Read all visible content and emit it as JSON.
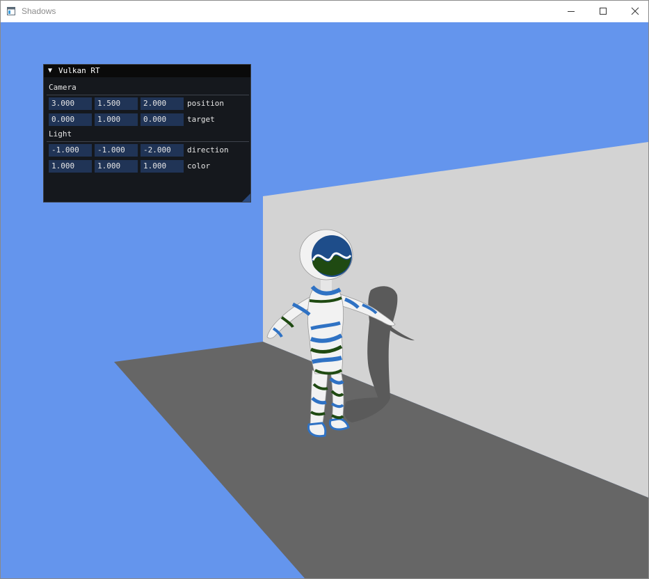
{
  "window": {
    "title": "Shadows"
  },
  "panel": {
    "title": "Vulkan RT",
    "camera": {
      "header": "Camera",
      "position": {
        "x": "3.000",
        "y": "1.500",
        "z": "2.000",
        "label": "position"
      },
      "target": {
        "x": "0.000",
        "y": "1.000",
        "z": "0.000",
        "label": "target"
      }
    },
    "light": {
      "header": "Light",
      "direction": {
        "x": "-1.000",
        "y": "-1.000",
        "z": "-2.000",
        "label": "direction"
      },
      "color": {
        "x": "1.000",
        "y": "1.000",
        "z": "1.000",
        "label": "color"
      }
    }
  },
  "colors": {
    "sky": "#6495ed",
    "floor": "#666666",
    "wall": "#d3d3d3",
    "shadow": "#5a5a5a",
    "panel_bg": "#15181d",
    "field_bg": "#203456",
    "character_white": "#f2f2f2",
    "character_blue": "#2f72c4",
    "character_green": "#1f4a12"
  }
}
